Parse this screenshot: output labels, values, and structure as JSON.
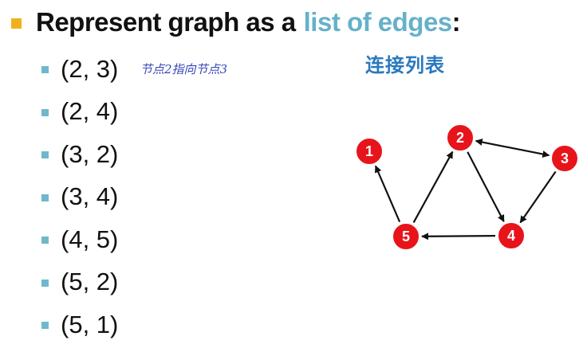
{
  "heading": {
    "prefix": "Represent graph as a",
    "highlight": "list of edges",
    "suffix": ":",
    "highlight_color": "#66b1c9"
  },
  "edges": [
    "(2, 3)",
    "(2, 4)",
    "(3, 2)",
    "(3, 4)",
    "(4, 5)",
    "(5, 2)",
    "(5, 1)"
  ],
  "annotation": "节点2指向节点3",
  "chinese_title": "连接列表",
  "graph": {
    "nodes": [
      {
        "id": "1",
        "label": "1"
      },
      {
        "id": "2",
        "label": "2"
      },
      {
        "id": "3",
        "label": "3"
      },
      {
        "id": "4",
        "label": "4"
      },
      {
        "id": "5",
        "label": "5"
      }
    ],
    "node_color": "#e8141c",
    "edges": [
      {
        "from": "2",
        "to": "3",
        "bidirectional": true
      },
      {
        "from": "2",
        "to": "4"
      },
      {
        "from": "3",
        "to": "4"
      },
      {
        "from": "4",
        "to": "5"
      },
      {
        "from": "5",
        "to": "2"
      },
      {
        "from": "5",
        "to": "1"
      }
    ]
  }
}
